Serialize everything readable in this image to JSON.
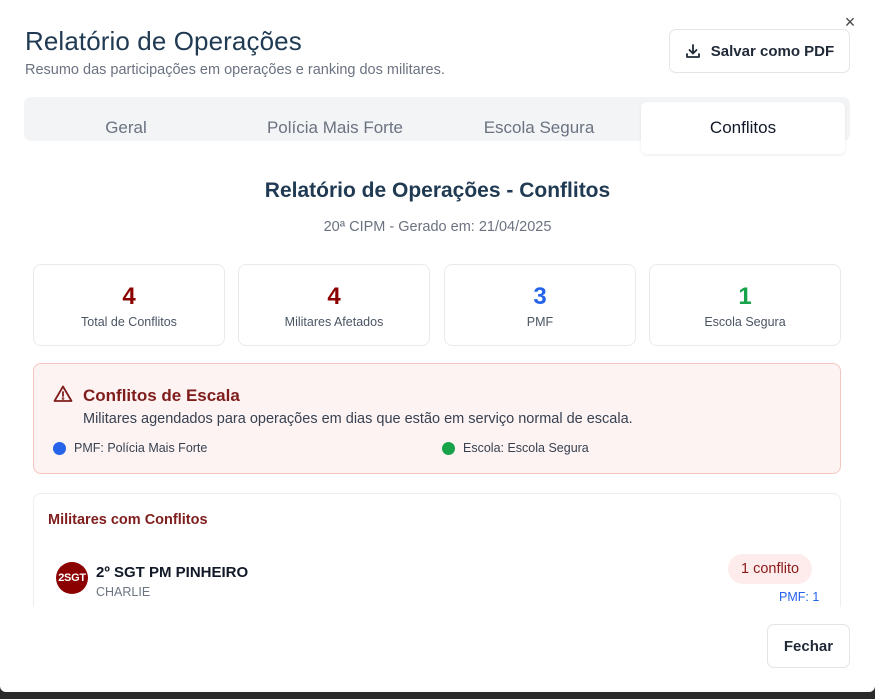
{
  "header": {
    "title": "Relatório de Operações",
    "subtitle": "Resumo das participações em operações e ranking dos militares.",
    "pdf_label": "Salvar como PDF",
    "close_symbol": "×"
  },
  "tabs": [
    {
      "label": "Geral",
      "active": false
    },
    {
      "label": "Polícia Mais Forte",
      "active": false
    },
    {
      "label": "Escola Segura",
      "active": false
    },
    {
      "label": "Conflitos",
      "active": true
    }
  ],
  "report": {
    "title": "Relatório de Operações - Conflitos",
    "subtitle": "20ª CIPM - Gerado em: 21/04/2025"
  },
  "stats": [
    {
      "value": "4",
      "label": "Total de Conflitos",
      "color": "#8b0000"
    },
    {
      "value": "4",
      "label": "Militares Afetados",
      "color": "#8b0000"
    },
    {
      "value": "3",
      "label": "PMF",
      "color": "#2563eb"
    },
    {
      "value": "1",
      "label": "Escola Segura",
      "color": "#16a34a"
    }
  ],
  "alert": {
    "icon": "warning-triangle-icon",
    "title": "Conflitos de Escala",
    "text": "Militares agendados para operações em dias que estão em serviço normal de escala.",
    "legend": [
      {
        "label": "PMF: Polícia Mais Forte",
        "color": "#2563eb"
      },
      {
        "label": "Escola: Escola Segura",
        "color": "#16a34a"
      }
    ]
  },
  "conflicts": {
    "title": "Militares com Conflitos",
    "rows": [
      {
        "avatar": "2SGT",
        "name": "2º SGT PM PINHEIRO",
        "sub": "CHARLIE",
        "badge": "1 conflito",
        "detail": "PMF: 1"
      }
    ]
  },
  "footer": {
    "close_label": "Fechar"
  }
}
